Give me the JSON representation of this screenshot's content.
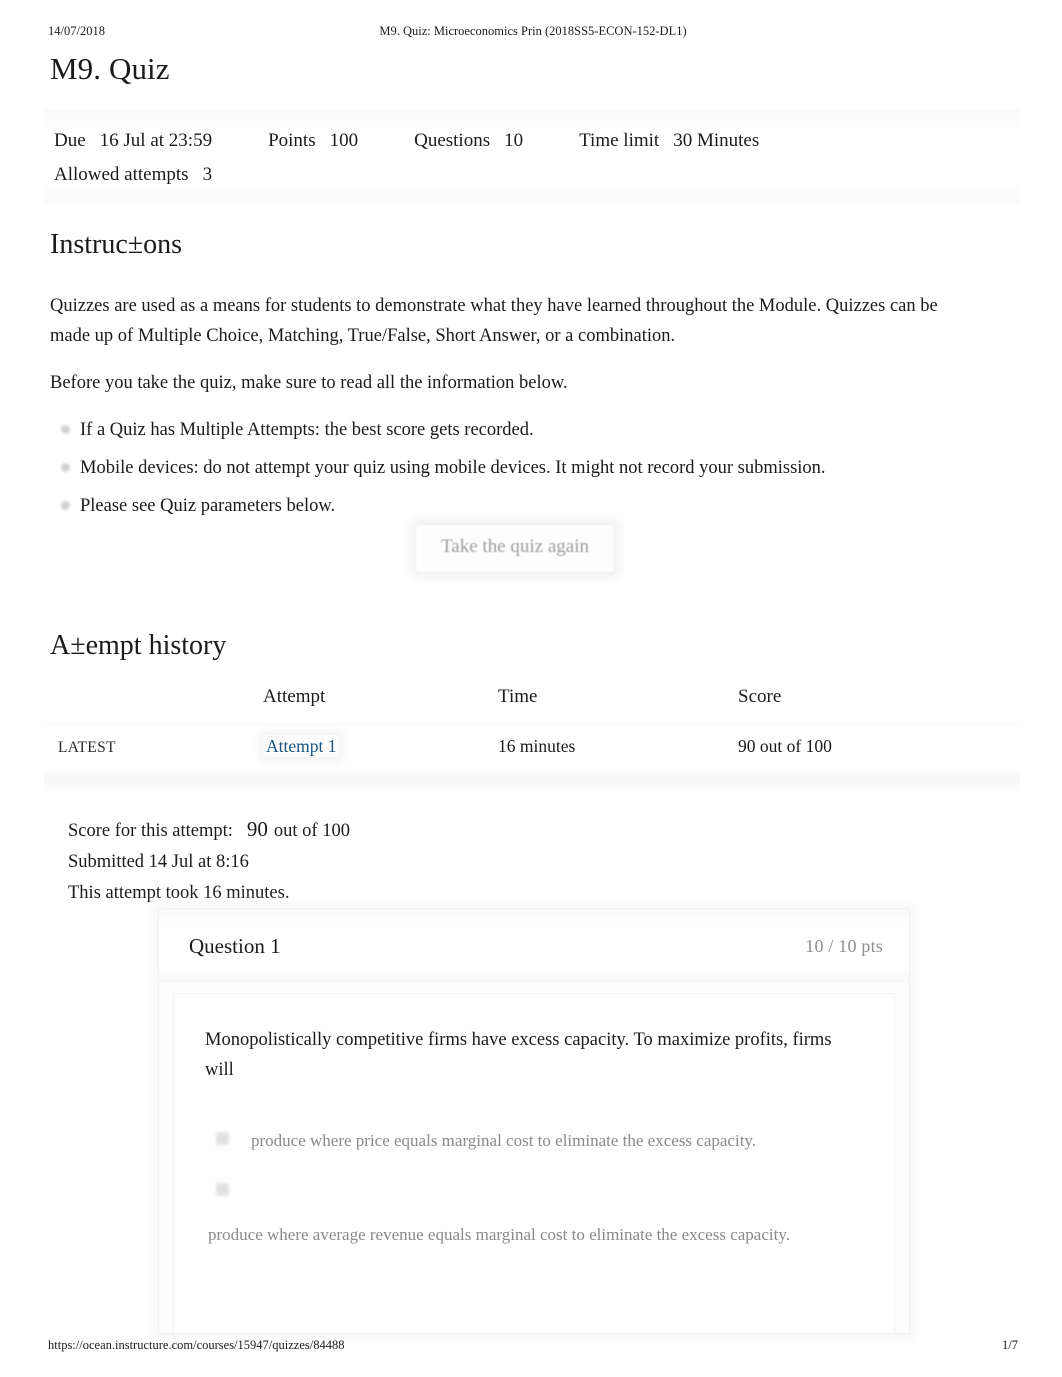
{
  "print_header": {
    "date": "14/07/2018",
    "title": "M9. Quiz: Microeconomics Prin (2018SS5-ECON-152-DL1)"
  },
  "page_title": "M9. Quiz",
  "quiz_details": {
    "due_label": "Due",
    "due_value": "16 Jul at 23:59",
    "points_label": "Points",
    "points_value": "100",
    "questions_label": "Questions",
    "questions_value": "10",
    "time_limit_label": "Time limit",
    "time_limit_value": "30 Minutes",
    "allowed_attempts_label": "Allowed attempts",
    "allowed_attempts_value": "3"
  },
  "instructions": {
    "heading": "Instruc±ons",
    "paragraph_1": "Quizzes are used as a means for students to demonstrate what they have learned throughout the Module. Quizzes can be made up of Multiple Choice, Matching, True/False, Short Answer, or a combination.",
    "paragraph_2": "Before you take the quiz, make sure to read all the information below.",
    "bullets": [
      "If a Quiz has Multiple Attempts: the best score gets recorded.",
      "Mobile devices: do not attempt your quiz using mobile devices. It might not record your submission.",
      "Please see Quiz parameters below."
    ]
  },
  "retake_button": {
    "label": "Take the quiz again"
  },
  "attempt_history": {
    "heading": "A±empt history",
    "columns": [
      "",
      "Attempt",
      "Time",
      "Score"
    ],
    "rows": [
      {
        "kept": "LATEST",
        "attempt": "Attempt 1",
        "time": "16 minutes",
        "score": "90 out of 100"
      }
    ]
  },
  "score_summary": {
    "score_label": "Score for this attempt:",
    "score_value": "90",
    "score_suffix": "out of 100",
    "submitted": "Submitted 14 Jul at 8:16",
    "duration": "This attempt took 16 minutes."
  },
  "question": {
    "label": "Question 1",
    "points": "10 / 10 pts",
    "text": "Monopolistically competitive firms have excess capacity. To maximize profits, firms will",
    "answers": [
      "produce where price equals marginal cost to eliminate the excess capacity.",
      "produce where average revenue equals marginal cost to eliminate the excess capacity."
    ]
  },
  "print_footer": {
    "url": "https://ocean.instructure.com/courses/15947/quizzes/84488",
    "page_number": "1/7"
  },
  "colors": {
    "link": "#1b5480",
    "text": "#1b1b1b",
    "muted": "#8f8f8f",
    "faded": "#9d9d9d"
  }
}
